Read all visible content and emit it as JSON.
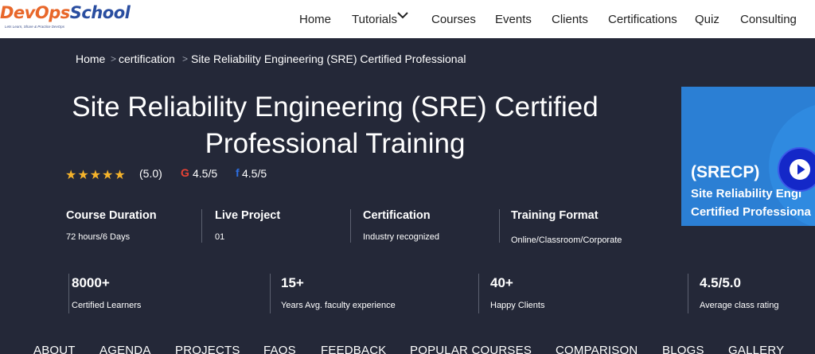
{
  "nav": {
    "logo": {
      "part1": "DevOps",
      "part2": "School",
      "tagline": "Lets Learn, Share & Practice DevOps"
    },
    "items": [
      "Home",
      "Tutorials",
      "Courses",
      "Events",
      "Clients",
      "Certifications",
      "Quiz",
      "Consulting"
    ],
    "dropdown_icon": "chevron-down-icon"
  },
  "breadcrumb": {
    "items": [
      "Home",
      "certification",
      "Site Reliability Engineering (SRE) Certified Professional"
    ],
    "separator": ">"
  },
  "hero": {
    "title_line1": "Site Reliability Engineering (SRE) Certified",
    "title_line2": "Professional Training",
    "rating": {
      "stars": "★★★★★",
      "star_value": 5,
      "score": "(5.0)",
      "google_icon": "G",
      "google_score": "4.5/5",
      "facebook_icon": "f",
      "facebook_score": "4.5/5"
    },
    "info": [
      {
        "title": "Course Duration",
        "value": "72 hours/6 Days"
      },
      {
        "title": "Live Project",
        "value": "01"
      },
      {
        "title": "Certification",
        "value": "Industry recognized"
      },
      {
        "title": "Training Format",
        "value": "Online/Classroom/Corporate"
      }
    ],
    "stats": [
      {
        "num": "8000+",
        "label": "Certified Learners"
      },
      {
        "num": "15+",
        "label": "Years Avg. faculty experience"
      },
      {
        "num": "40+",
        "label": "Happy Clients"
      },
      {
        "num": "4.5/5.0",
        "label": "Average class rating"
      }
    ]
  },
  "card": {
    "abbr": "(SRECP)",
    "line1": "Site Reliability Engi",
    "line2": "Certified Professiona",
    "play_icon": "play-icon"
  },
  "tabs": [
    "ABOUT",
    "AGENDA",
    "PROJECTS",
    "FAQS",
    "FEEDBACK",
    "POPULAR COURSES",
    "COMPARISON",
    "BLOGS",
    "GALLERY"
  ],
  "colors": {
    "hero_bg": "#242838",
    "star": "#f5b32b",
    "google": "#ea4335",
    "facebook": "#2d6fe3",
    "card_bg": "#2b7fd4",
    "play_bg": "#1428c8",
    "logo_orange": "#e8672a",
    "logo_blue": "#2a4ea0"
  }
}
